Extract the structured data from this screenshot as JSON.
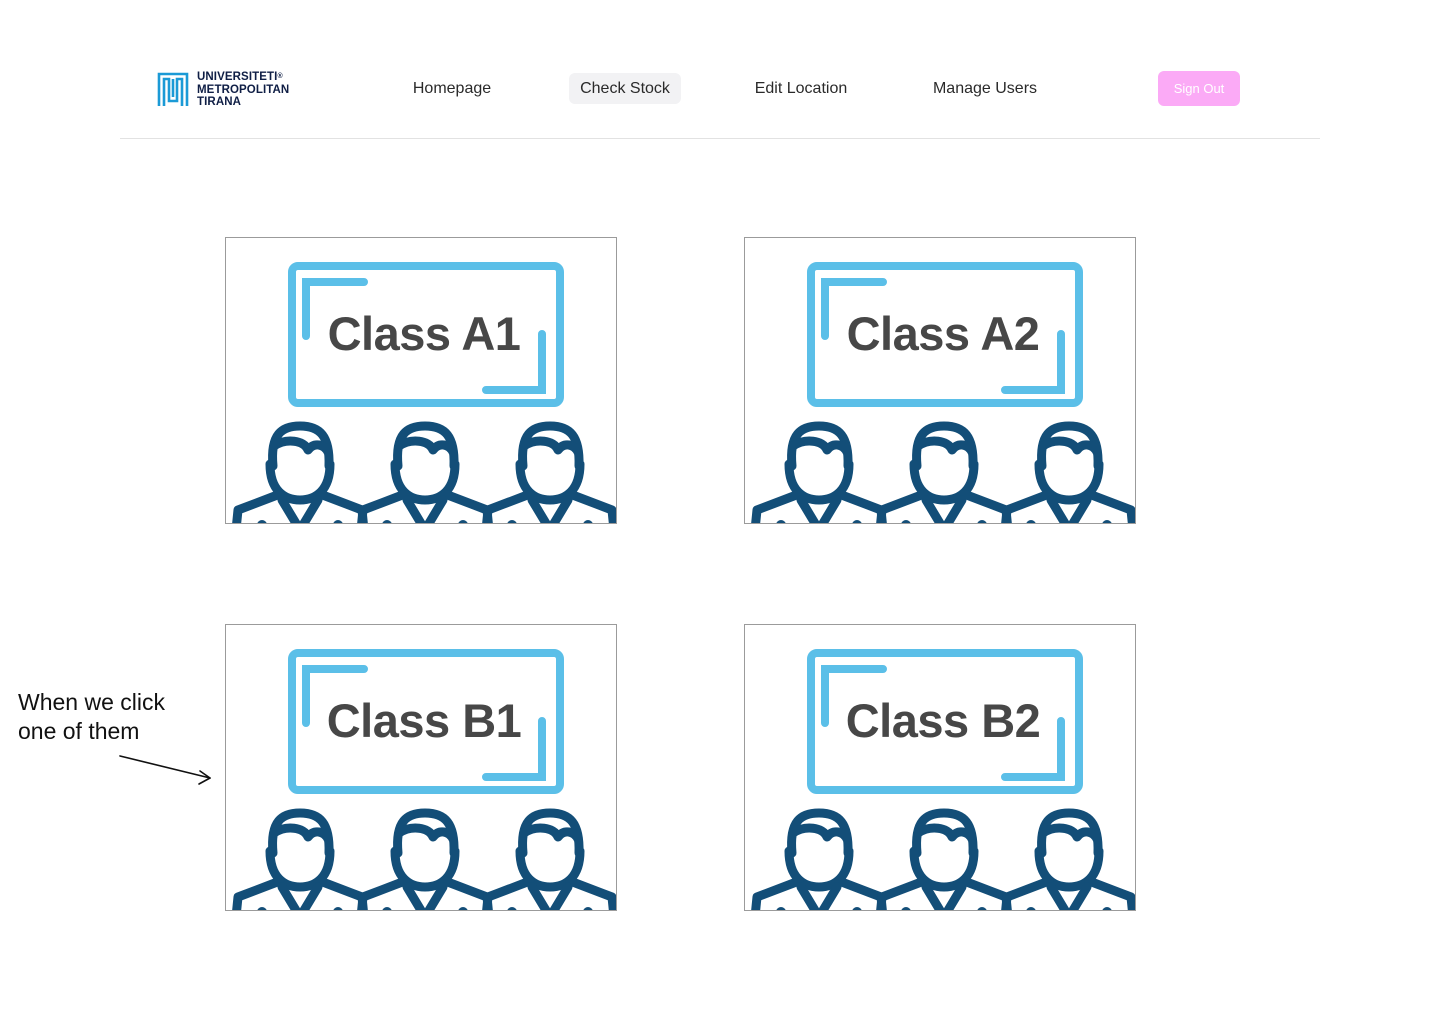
{
  "header": {
    "logo": {
      "lines": [
        "UNIVERSITETI",
        "METROPOLITAN",
        "TIRANA"
      ],
      "registered_mark": "®",
      "color": "#1b9ad6"
    },
    "nav": {
      "homepage": "Homepage",
      "check_stock": "Check Stock",
      "edit_location": "Edit Location",
      "manage_users": "Manage Users",
      "active": "check_stock"
    },
    "sign_out_label": "Sign Out",
    "sign_out_color": "#fbaaf6"
  },
  "classes": [
    {
      "label": "Class A1"
    },
    {
      "label": "Class A2"
    },
    {
      "label": "Class B1"
    },
    {
      "label": "Class B2"
    }
  ],
  "illustration": {
    "board_color": "#5bbfe8",
    "people_color": "#134e78",
    "icon": "classroom-board-students-icon"
  },
  "annotation": {
    "line1": "When we click",
    "line2": "one of them"
  }
}
